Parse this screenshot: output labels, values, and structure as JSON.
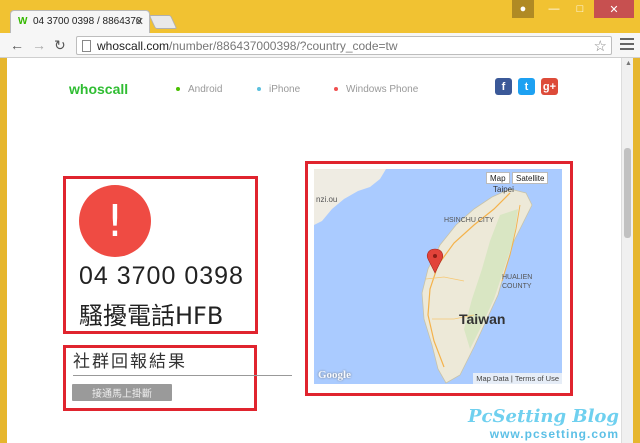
{
  "browser": {
    "tab_title": "04 3700 0398 / 8864370",
    "tab_favicon": "W",
    "url_host": "whoscall.com",
    "url_path": "/number/886437000398/?country_code=tw"
  },
  "site": {
    "brand": "whoscall",
    "nav": [
      {
        "label": "Android",
        "dot_color": "#49c000"
      },
      {
        "label": "iPhone",
        "dot_color": "#5bc0de"
      },
      {
        "label": "Windows Phone",
        "dot_color": "#f05050"
      }
    ],
    "social": [
      {
        "icon": "facebook-icon",
        "glyph": "f",
        "color": "#3b5998"
      },
      {
        "icon": "twitter-icon",
        "glyph": "t",
        "color": "#1da1f2"
      },
      {
        "icon": "google-plus-icon",
        "glyph": "g+",
        "color": "#dd4b39"
      }
    ]
  },
  "result": {
    "alert_symbol": "!",
    "phone_number": "04 3700 0398",
    "tag": "騷擾電話HFB"
  },
  "report": {
    "title": "社群回報結果",
    "button": "接通馬上掛斷"
  },
  "map": {
    "type_map": "Map",
    "type_satellite": "Satellite",
    "label_taiwan": "Taiwan",
    "label_taipei": "Taipei",
    "label_hsinchu": "HSINCHU CITY",
    "label_hualien": "HUALIEN COUNTY",
    "label_inzlou": "nzi.ou",
    "attribution_data": "Map Data",
    "attribution_terms": "Terms of Use",
    "google": "Google"
  },
  "watermark": {
    "title": "PcSetting Blog",
    "url": "www.pcsetting.com"
  }
}
